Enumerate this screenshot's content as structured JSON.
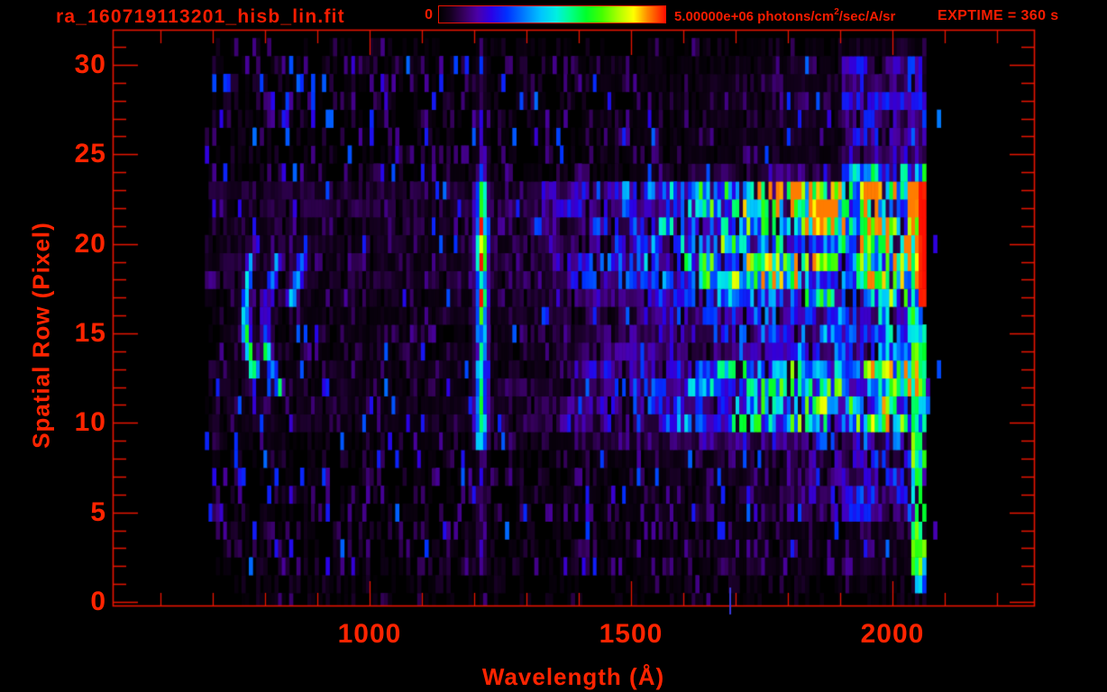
{
  "header": {
    "title": "ra_160719113201_hisb_lin.fit",
    "colorbar": {
      "min_label": "0",
      "max_label_prefix": "5.00000e+06 photons/cm",
      "max_label_sup": "2",
      "max_label_suffix": "/sec/A/sr"
    },
    "exptime_label": "EXPTIME = 360 s"
  },
  "colors": {
    "background": "#000000",
    "accent_text": "#ff2200",
    "frame": "#e81400"
  },
  "chart_data": {
    "type": "heatmap",
    "title": "ra_160719113201_hisb_lin.fit",
    "xlabel": "Wavelength (Å)",
    "ylabel": "Spatial Row (Pixel)",
    "xlim_A": [
      509,
      2272
    ],
    "ylim_rows": [
      -0.3,
      31.9
    ],
    "x_ticks": [
      1000,
      1500,
      2000
    ],
    "x_minor_tick_step_A": 100,
    "y_ticks": [
      0,
      5,
      10,
      15,
      20,
      25,
      30
    ],
    "y_minor_tick_step": 1,
    "grid": false,
    "colorbar": {
      "min": 0,
      "max": 5000000,
      "units": "photons/cm2/sec/A/sr",
      "position": "top"
    },
    "exposure_s": 360,
    "data_extent": {
      "wavelength_A": [
        685,
        2066
      ],
      "rows": [
        0,
        31
      ]
    },
    "colormap_stops": [
      {
        "t": 0.0,
        "c": "#000000"
      },
      {
        "t": 0.05,
        "c": "#14001e"
      },
      {
        "t": 0.11,
        "c": "#36005e"
      },
      {
        "t": 0.17,
        "c": "#4b00a8"
      },
      {
        "t": 0.23,
        "c": "#2b00e6"
      },
      {
        "t": 0.3,
        "c": "#0030ff"
      },
      {
        "t": 0.38,
        "c": "#0080ff"
      },
      {
        "t": 0.45,
        "c": "#00c4ff"
      },
      {
        "t": 0.52,
        "c": "#00f0e0"
      },
      {
        "t": 0.58,
        "c": "#00ff8c"
      },
      {
        "t": 0.65,
        "c": "#00ff2a"
      },
      {
        "t": 0.72,
        "c": "#44ff00"
      },
      {
        "t": 0.79,
        "c": "#a8ff00"
      },
      {
        "t": 0.86,
        "c": "#ffff00"
      },
      {
        "t": 0.92,
        "c": "#ff8c00"
      },
      {
        "t": 1.0,
        "c": "#ff1000"
      }
    ],
    "row_profile": [
      [
        0,
        1.5,
        0.02
      ],
      [
        1.5,
        4.5,
        0.05
      ],
      [
        4.5,
        8.5,
        0.11
      ],
      [
        8.5,
        9.2,
        0.35
      ],
      [
        9.2,
        13.8,
        0.85
      ],
      [
        13.8,
        16.6,
        0.48
      ],
      [
        16.6,
        17.2,
        0.7
      ],
      [
        17.2,
        23.4,
        1.15
      ],
      [
        23.4,
        24.4,
        0.18
      ],
      [
        24.4,
        31,
        0.08
      ]
    ],
    "spectral_ramp": [
      [
        685,
        0.05
      ],
      [
        900,
        0.055
      ],
      [
        1100,
        0.06
      ],
      [
        1250,
        0.08
      ],
      [
        1350,
        0.12
      ],
      [
        1450,
        0.22
      ],
      [
        1550,
        0.32
      ],
      [
        1650,
        0.45
      ],
      [
        1750,
        0.57
      ],
      [
        1850,
        0.67
      ],
      [
        1950,
        0.76
      ],
      [
        2030,
        0.84
      ],
      [
        2066,
        0.88
      ]
    ],
    "features": [
      {
        "name": "lyman-alpha-emission-line",
        "wavelength_A": 1214,
        "sigma_A": 7,
        "rows": [
          2,
          31
        ],
        "row_intensity": [
          [
            2,
            9,
            0.1
          ],
          [
            9,
            12,
            0.55
          ],
          [
            12,
            16.6,
            0.5
          ],
          [
            16.6,
            23.5,
            0.7
          ],
          [
            23.5,
            24.6,
            0.32
          ],
          [
            24.6,
            31,
            0.06
          ]
        ]
      },
      {
        "name": "arc-feature-1",
        "type": "arc",
        "apex_wavelength_A": 762,
        "apex_row": 16.2,
        "row_halfspan": 3.9,
        "rows": [
          12.3,
          20.1
        ],
        "curvature_A": 22,
        "sigma_A": 5.5,
        "intensity": 0.55
      },
      {
        "name": "arc-feature-2",
        "type": "arc",
        "apex_wavelength_A": 801,
        "apex_row": 15.6,
        "row_halfspan": 3.8,
        "rows": [
          11.8,
          19.4
        ],
        "curvature_A": 27,
        "sigma_A": 6,
        "intensity": 0.5
      },
      {
        "name": "diagonal-streak",
        "type": "streak",
        "rows": [
          16.4,
          19.6
        ],
        "wavelength_base_A": 845,
        "slope_A_per_row": 10,
        "sigma_A": 7,
        "intensity": 0.38
      },
      {
        "name": "bright-continuum-band",
        "rows": [
          17.2,
          23.4
        ],
        "wavelength_A": [
          1300,
          2066
        ],
        "gradient": "green to yellow to orange toward long wavelengths",
        "encoded_by": "row_profile x spectral_ramp"
      },
      {
        "name": "mid-continuum-band",
        "rows": [
          9.2,
          16.6
        ],
        "wavelength_A": [
          1400,
          2066
        ],
        "gradient": "blue to cyan to green toward long wavelengths",
        "encoded_by": "row_profile x spectral_ramp"
      },
      {
        "name": "saturated-right-edge-column",
        "wavelength_A": [
          2052,
          2066
        ],
        "rows": [
          16.8,
          23.6
        ],
        "intensity": 0.97
      },
      {
        "name": "right-edge-green-column",
        "wavelength_A": [
          2036,
          2062
        ],
        "rows": [
          1.5,
          16.8
        ],
        "intensity": 0.6
      }
    ],
    "artifacts": [
      {
        "name": "stray-blue-line-below-axis",
        "wavelength_A": 1688,
        "rows": [
          -0.7,
          0.8
        ],
        "color": "#3a3ae0"
      }
    ]
  }
}
